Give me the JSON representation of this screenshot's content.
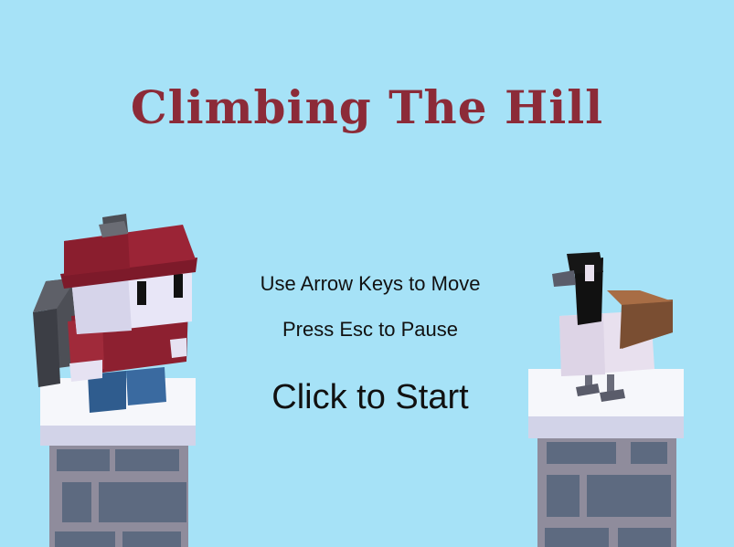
{
  "title": "Climbing The Hill",
  "instructions": {
    "move": "Use Arrow Keys to Move",
    "pause": "Press Esc to Pause"
  },
  "start_label": "Click to Start",
  "colors": {
    "sky": "#a6e2f7",
    "title": "#8c2b38",
    "hat": "#9b2436",
    "jacket": "#8d2030",
    "pants": "#2f5c8e",
    "backpack": "#4d4f56",
    "snow": "#f6f7fb",
    "snow_shade": "#d2d3e8",
    "brick": "#5d6a80",
    "mortar": "#8f8c9c",
    "goose_body": "#e8e0ee",
    "goose_wing": "#8a5a3a",
    "goose_neck": "#111111"
  }
}
